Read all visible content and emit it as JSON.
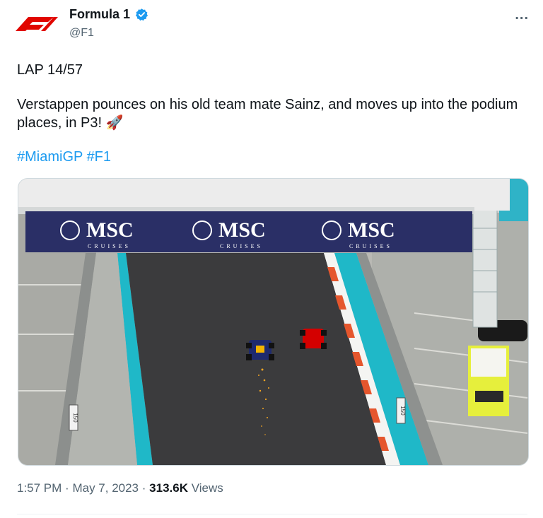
{
  "account": {
    "display_name": "Formula 1",
    "handle": "@F1",
    "more_icon": "..."
  },
  "tweet": {
    "line1": "LAP 14/57",
    "line2": "Verstappen pounces on his old team mate Sainz, and moves up into the podium places, in P3! 🚀",
    "hashtags": [
      "#MiamiGP",
      "#F1"
    ]
  },
  "media": {
    "banner_brand": "MSC",
    "banner_sub": "CRUISES",
    "distance_marker": "150"
  },
  "meta": {
    "time": "1:57 PM",
    "date": "May 7, 2023",
    "views_count": "313.6K",
    "views_label": "Views",
    "separator": "·"
  },
  "colors": {
    "link": "#1d9bf0",
    "verified": "#1d9bf0",
    "f1_red": "#e10600",
    "banner": "#2a2f66",
    "track": "#3a3a3a",
    "kerb_teal": "#1fb8c8"
  }
}
